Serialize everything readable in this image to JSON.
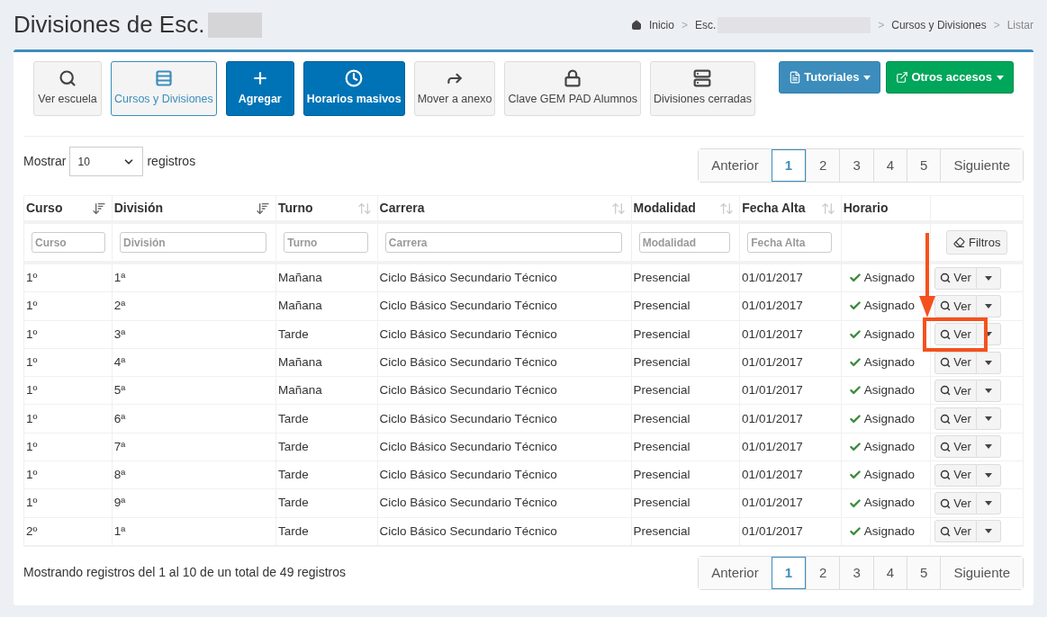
{
  "header": {
    "title": "Divisiones de Esc.",
    "title_redacted": true,
    "breadcrumb": [
      {
        "label": "Inicio",
        "redacted": false
      },
      {
        "separator": ">",
        "label": "Esc.",
        "redacted": true
      },
      {
        "separator": ">",
        "label": "Cursos y Divisiones",
        "redacted": false
      },
      {
        "separator": ">",
        "label": "Listar"
      }
    ]
  },
  "toolbar": [
    {
      "label": "Ver escuela",
      "kind": "default"
    },
    {
      "label": "Cursos y Divisiones",
      "kind": "active"
    },
    {
      "label": "Agregar",
      "kind": "primary"
    },
    {
      "label": "Horarios masivos",
      "kind": "primary"
    },
    {
      "label": "Mover a anexo",
      "kind": "default"
    },
    {
      "label": "Clave GEM PAD Alumnos",
      "kind": "default"
    },
    {
      "label": "Divisiones cerradas",
      "kind": "default"
    }
  ],
  "menus": [
    {
      "label": "Tutoriales",
      "kind": "info"
    },
    {
      "label": "Otros accesos",
      "kind": "success"
    }
  ],
  "length": {
    "prefix": "Mostrar",
    "value": "10",
    "suffix": "registros"
  },
  "pagination_top": [
    {
      "label": "Anterior",
      "selected": false
    },
    {
      "label": "1",
      "selected": true
    },
    {
      "label": "2",
      "selected": false
    },
    {
      "label": "3",
      "selected": false
    },
    {
      "label": "4",
      "selected": false
    },
    {
      "label": "5",
      "selected": false
    },
    {
      "label": "Siguiente",
      "selected": false
    }
  ],
  "table": {
    "columns": [
      {
        "label": "Curso",
        "sorted": true,
        "placeholder": "Curso"
      },
      {
        "label": "División",
        "sorted": true,
        "placeholder": "División"
      },
      {
        "label": "Turno",
        "sorted": false,
        "placeholder": "Turno"
      },
      {
        "label": "Carrera",
        "sorted": false,
        "placeholder": "Carrera"
      },
      {
        "label": "Modalidad",
        "sorted": false,
        "placeholder": "Modalidad"
      },
      {
        "label": "Fecha Alta",
        "sorted": false,
        "placeholder": "Fecha Alta"
      },
      {
        "label": "Horario"
      }
    ],
    "filter_button": "Filtros",
    "rows": [
      {
        "curso": "1º",
        "division": "1ª",
        "turno": "Mañana",
        "carrera": "Ciclo Básico Secundario Técnico",
        "modalidad": "Presencial",
        "fecha": "01/01/2017",
        "horario": "Asignado",
        "action": "Ver",
        "highlighted": false
      },
      {
        "curso": "1º",
        "division": "2ª",
        "turno": "Mañana",
        "carrera": "Ciclo Básico Secundario Técnico",
        "modalidad": "Presencial",
        "fecha": "01/01/2017",
        "horario": "Asignado",
        "action": "Ver",
        "highlighted": false
      },
      {
        "curso": "1º",
        "division": "3ª",
        "turno": "Tarde",
        "carrera": "Ciclo Básico Secundario Técnico",
        "modalidad": "Presencial",
        "fecha": "01/01/2017",
        "horario": "Asignado",
        "action": "Ver",
        "highlighted": true
      },
      {
        "curso": "1º",
        "division": "4ª",
        "turno": "Mañana",
        "carrera": "Ciclo Básico Secundario Técnico",
        "modalidad": "Presencial",
        "fecha": "01/01/2017",
        "horario": "Asignado",
        "action": "Ver",
        "highlighted": false
      },
      {
        "curso": "1º",
        "division": "5ª",
        "turno": "Mañana",
        "carrera": "Ciclo Básico Secundario Técnico",
        "modalidad": "Presencial",
        "fecha": "01/01/2017",
        "horario": "Asignado",
        "action": "Ver",
        "highlighted": false
      },
      {
        "curso": "1º",
        "division": "6ª",
        "turno": "Tarde",
        "carrera": "Ciclo Básico Secundario Técnico",
        "modalidad": "Presencial",
        "fecha": "01/01/2017",
        "horario": "Asignado",
        "action": "Ver",
        "highlighted": false
      },
      {
        "curso": "1º",
        "division": "7ª",
        "turno": "Tarde",
        "carrera": "Ciclo Básico Secundario Técnico",
        "modalidad": "Presencial",
        "fecha": "01/01/2017",
        "horario": "Asignado",
        "action": "Ver",
        "highlighted": false
      },
      {
        "curso": "1º",
        "division": "8ª",
        "turno": "Tarde",
        "carrera": "Ciclo Básico Secundario Técnico",
        "modalidad": "Presencial",
        "fecha": "01/01/2017",
        "horario": "Asignado",
        "action": "Ver",
        "highlighted": false
      },
      {
        "curso": "1º",
        "division": "9ª",
        "turno": "Tarde",
        "carrera": "Ciclo Básico Secundario Técnico",
        "modalidad": "Presencial",
        "fecha": "01/01/2017",
        "horario": "Asignado",
        "action": "Ver",
        "highlighted": false
      },
      {
        "curso": "2º",
        "division": "1ª",
        "turno": "Tarde",
        "carrera": "Ciclo Básico Secundario Técnico",
        "modalidad": "Presencial",
        "fecha": "01/01/2017",
        "horario": "Asignado",
        "action": "Ver",
        "highlighted": false
      }
    ]
  },
  "info": "Mostrando registros del 1 al 10 de un total de 49 registros",
  "pagination_bottom": [
    {
      "label": "Anterior",
      "selected": false
    },
    {
      "label": "1",
      "selected": true
    },
    {
      "label": "2",
      "selected": false
    },
    {
      "label": "3",
      "selected": false
    },
    {
      "label": "4",
      "selected": false
    },
    {
      "label": "5",
      "selected": false
    },
    {
      "label": "Siguiente",
      "selected": false
    }
  ]
}
